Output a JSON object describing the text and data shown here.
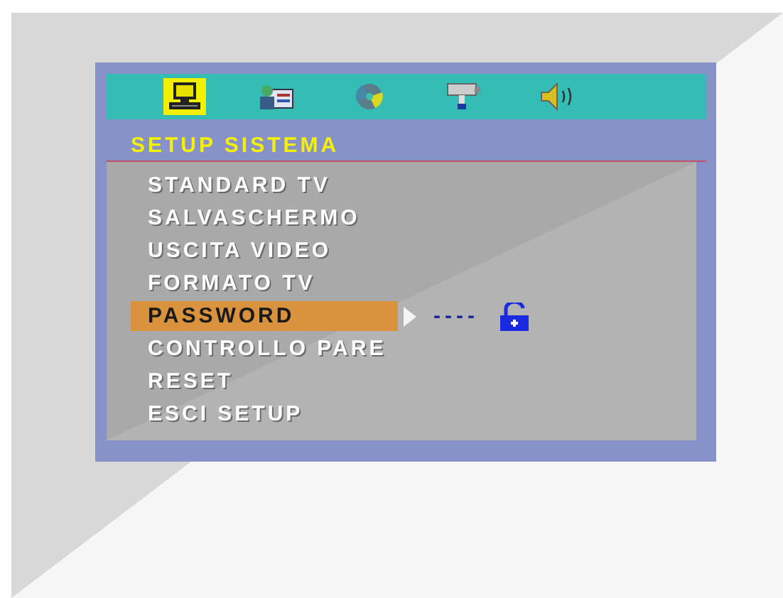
{
  "tabs": [
    {
      "kind": "computer",
      "selected": true
    },
    {
      "kind": "card",
      "selected": false
    },
    {
      "kind": "disc",
      "selected": false
    },
    {
      "kind": "camera",
      "selected": false
    },
    {
      "kind": "speaker",
      "selected": false
    }
  ],
  "title": "SETUP SISTEMA",
  "items": [
    {
      "label": "STANDARD TV",
      "selected": false
    },
    {
      "label": "SALVASCHERMO",
      "selected": false
    },
    {
      "label": "USCITA VIDEO",
      "selected": false
    },
    {
      "label": "FORMATO TV",
      "selected": false
    },
    {
      "label": "PASSWORD",
      "selected": true
    },
    {
      "label": "CONTROLLO PARE",
      "selected": false
    },
    {
      "label": "RESET",
      "selected": false
    },
    {
      "label": "ESCI SETUP",
      "selected": false
    }
  ],
  "password": {
    "value": "----",
    "locked": false
  }
}
